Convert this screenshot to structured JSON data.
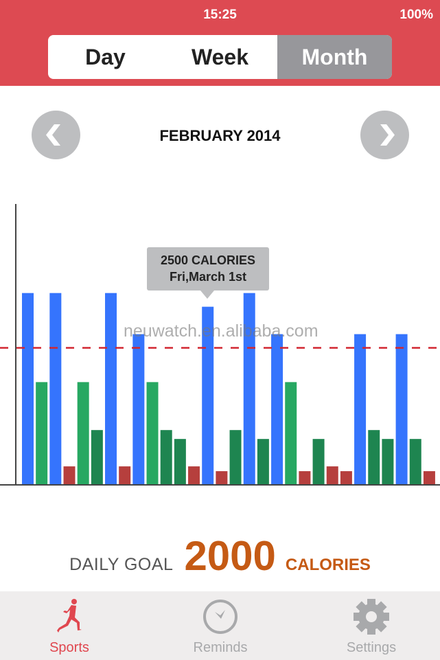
{
  "status_bar": {
    "time": "15:25",
    "battery": "100%"
  },
  "segments": {
    "items": [
      "Day",
      "Week",
      "Month"
    ],
    "selected": "Month"
  },
  "period": {
    "title": "FEBRUARY 2014",
    "prev_icon": "chevron-left-icon",
    "next_icon": "chevron-right-icon"
  },
  "tooltip": {
    "line1": "2500 CALORIES",
    "line2": "Fri,March 1st"
  },
  "watermark": "neuwatch.en.alibaba.com",
  "goal": {
    "label": "DAILY GOAL",
    "value": "2000",
    "unit": "CALORIES"
  },
  "tabs": [
    {
      "label": "Sports",
      "icon": "runner-icon",
      "active": true
    },
    {
      "label": "Reminds",
      "icon": "clock-icon",
      "active": false
    },
    {
      "label": "Settings",
      "icon": "gear-icon",
      "active": false
    }
  ],
  "colors": {
    "header": "#dd4a52",
    "accent": "#c55a14",
    "active_tab": "#e0474f",
    "inactive_tab": "#a8a9ab"
  },
  "chart_data": {
    "type": "bar",
    "ylim": [
      0,
      4100
    ],
    "goal_line": 2000,
    "grid": false,
    "bars": [
      {
        "value": 2800,
        "color": "#3574fd"
      },
      {
        "value": 1500,
        "color": "#27a862"
      },
      {
        "value": 2800,
        "color": "#3574fd"
      },
      {
        "value": 270,
        "color": "#b63f3d"
      },
      {
        "value": 1500,
        "color": "#27a862"
      },
      {
        "value": 800,
        "color": "#1e8550"
      },
      {
        "value": 2800,
        "color": "#3574fd"
      },
      {
        "value": 270,
        "color": "#b63f3d"
      },
      {
        "value": 2200,
        "color": "#3574fd"
      },
      {
        "value": 1500,
        "color": "#27a862"
      },
      {
        "value": 800,
        "color": "#1e8550"
      },
      {
        "value": 670,
        "color": "#1e8550"
      },
      {
        "value": 270,
        "color": "#b63f3d"
      },
      {
        "value": 2600,
        "color": "#3574fd"
      },
      {
        "value": 200,
        "color": "#b63f3d"
      },
      {
        "value": 800,
        "color": "#1e8550"
      },
      {
        "value": 2800,
        "color": "#3574fd"
      },
      {
        "value": 670,
        "color": "#1e8550"
      },
      {
        "value": 2200,
        "color": "#3574fd"
      },
      {
        "value": 1500,
        "color": "#27a862"
      },
      {
        "value": 200,
        "color": "#b63f3d"
      },
      {
        "value": 670,
        "color": "#1e8550"
      },
      {
        "value": 270,
        "color": "#b63f3d"
      },
      {
        "value": 200,
        "color": "#b63f3d"
      },
      {
        "value": 2200,
        "color": "#3574fd"
      },
      {
        "value": 800,
        "color": "#1e8550"
      },
      {
        "value": 670,
        "color": "#1e8550"
      },
      {
        "value": 2200,
        "color": "#3574fd"
      },
      {
        "value": 670,
        "color": "#1e8550"
      },
      {
        "value": 200,
        "color": "#b63f3d"
      }
    ]
  }
}
